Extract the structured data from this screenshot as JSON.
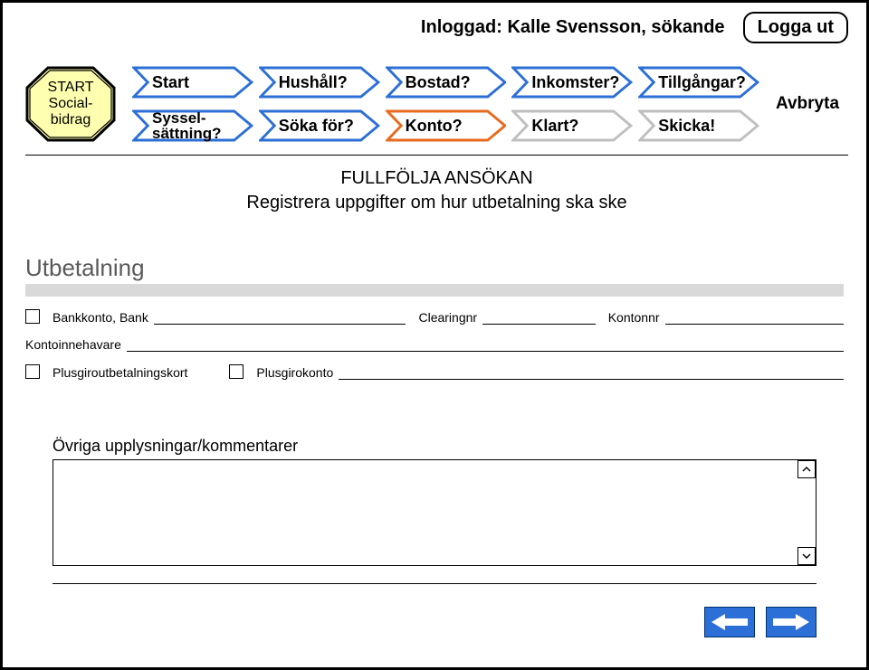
{
  "header": {
    "login_text": "Inloggad: Kalle Svensson, sökande",
    "logout_label": "Logga ut"
  },
  "start_badge": {
    "line1": "START",
    "line2": "Social-",
    "line3": "bidrag"
  },
  "nav": {
    "row1": [
      "Start",
      "Hushåll?",
      "Bostad?",
      "Inkomster?",
      "Tillgångar?"
    ],
    "row2": [
      "Syssel-\nsättning?",
      "Söka för?",
      "Konto?",
      "Klart?",
      "Skicka!"
    ],
    "abort": "Avbryta"
  },
  "title": {
    "line1": "FULLFÖLJA ANSÖKAN",
    "line2": "Registrera uppgifter om hur utbetalning ska ske"
  },
  "form": {
    "section": "Utbetalning",
    "bankkonto": "Bankkonto,  Bank",
    "clearing": "Clearingnr",
    "kontonr": "Kontonnr",
    "kontoinnehavare": "Kontoinnehavare",
    "plusgirokort": "Plusgiroutbetalningskort",
    "plusgirokonto": "Plusgirokonto"
  },
  "comments_label": "Övriga upplysningar/kommentarer",
  "colors": {
    "blue": "#2c6fd6",
    "orange": "#e76a1e",
    "grey": "#bfbfbf"
  }
}
